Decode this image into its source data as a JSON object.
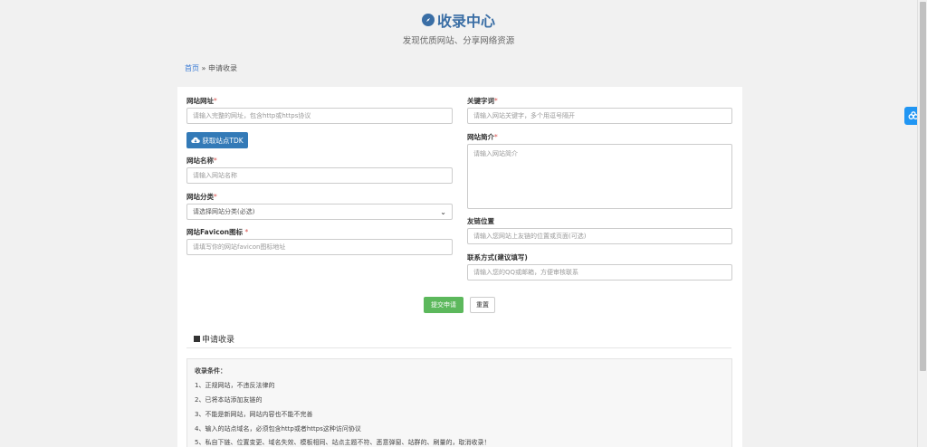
{
  "header": {
    "title": "收录中心",
    "subtitle": "发现优质网站、分享网络资源",
    "logo_icon": "compass-icon"
  },
  "breadcrumb": {
    "home": "首页",
    "separator": " » ",
    "current": "申请收录"
  },
  "form": {
    "url": {
      "label": "网站网址",
      "required": "*",
      "placeholder": "请输入完整的网址，包含http或https协议"
    },
    "tdk_button": "获取站点TDK",
    "name": {
      "label": "网站名称",
      "required": "*",
      "placeholder": "请输入网站名称"
    },
    "category": {
      "label": "网站分类",
      "required": "*",
      "selected": "请选择网站分类(必选)"
    },
    "favicon": {
      "label": "网站Favicon图标",
      "required": " *",
      "placeholder": "请填写你的网站favicon图标地址"
    },
    "keywords": {
      "label": "关键字词",
      "required": "*",
      "placeholder": "请输入网站关键字，多个用逗号隔开"
    },
    "intro": {
      "label": "网站简介",
      "required": "*",
      "placeholder": "请输入网站简介"
    },
    "friend_link": {
      "label": "友链位置",
      "placeholder": "请输入您网站上友链的位置或页面(可选)"
    },
    "contact": {
      "label": "联系方式(建议填写)",
      "placeholder": "请输入您的QQ或邮箱，方便审核联系"
    },
    "submit_button": "提交申请",
    "reset_button": "重置"
  },
  "section": {
    "title": "申请收录"
  },
  "rules": {
    "heading": "收录条件：",
    "items": [
      "1、正规网站，不违反法律的",
      "2、已将本站添加友链的",
      "3、不能是新网站，网站内容也不能不完善",
      "4、输入的站点域名，必须包含http或者https这种访问协议",
      "5、私自下链、位置变更、域名失效、模板相同、站点主题不符、恶意弹窗、站群的、刷量的，取消收录！"
    ]
  },
  "colors": {
    "brand": "#3a6ea5",
    "primary_button": "#337ab7",
    "submit_button": "#5cb85c",
    "required": "#d9534f",
    "float_button": "#2196f3"
  }
}
